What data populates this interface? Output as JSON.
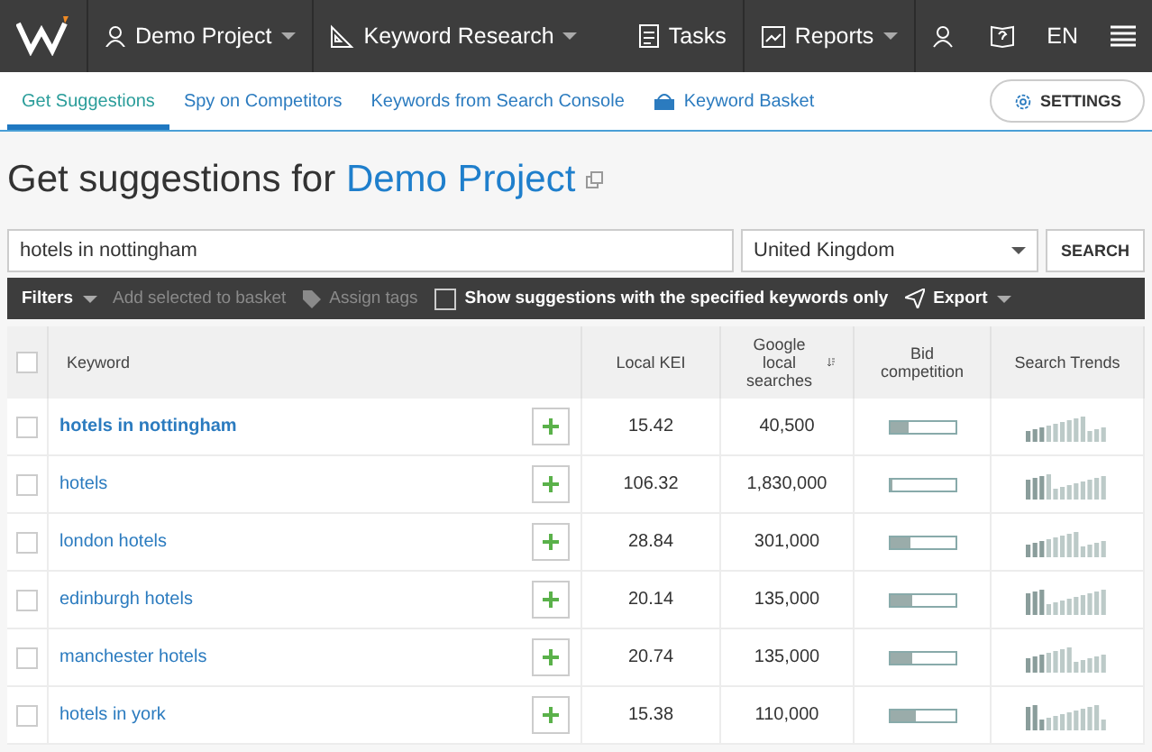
{
  "top_bar": {
    "project": "Demo Project",
    "module": "Keyword Research",
    "tasks": "Tasks",
    "reports": "Reports",
    "language": "EN"
  },
  "tabs": [
    {
      "label": "Get Suggestions",
      "selected": true,
      "kind": "text"
    },
    {
      "label": "Spy on Competitors",
      "selected": false,
      "kind": "text"
    },
    {
      "label": "Keywords from Search Console",
      "selected": false,
      "kind": "text"
    },
    {
      "label": "Keyword Basket",
      "selected": false,
      "kind": "basket"
    }
  ],
  "settings_button": "SETTINGS",
  "heading": {
    "prefix": "Get suggestions for",
    "project": "Demo Project"
  },
  "search": {
    "value": "hotels in nottingham",
    "country": "United Kingdom",
    "button": "SEARCH"
  },
  "toolbar": {
    "filters": "Filters",
    "add_to_basket": "Add selected to basket",
    "assign_tags": "Assign tags",
    "only_specified": {
      "label": "Show suggestions with the specified keywords only",
      "checked": false
    },
    "export": "Export"
  },
  "table": {
    "select_all_checked": false,
    "columns": [
      "Keyword",
      "Local KEI",
      "Google local searches",
      "Bid competition",
      "Search Trends"
    ],
    "rows": [
      {
        "keyword": "hotels in nottingham",
        "emphasized": true,
        "checked": false,
        "kei": "15.42",
        "searches": "40,500",
        "level": 0.3
      },
      {
        "keyword": "hotels",
        "emphasized": false,
        "checked": false,
        "kei": "106.32",
        "searches": "1,830,000",
        "level": 0.05
      },
      {
        "keyword": "london hotels",
        "emphasized": false,
        "checked": false,
        "kei": "28.84",
        "searches": "301,000",
        "level": 0.32
      },
      {
        "keyword": "edinburgh hotels",
        "emphasized": false,
        "checked": false,
        "kei": "20.14",
        "searches": "135,000",
        "level": 0.34
      },
      {
        "keyword": "manchester hotels",
        "emphasized": false,
        "checked": false,
        "kei": "20.74",
        "searches": "135,000",
        "level": 0.34
      },
      {
        "keyword": "hotels in york",
        "emphasized": false,
        "checked": false,
        "kei": "15.38",
        "searches": "110,000",
        "level": 0.41
      }
    ]
  }
}
